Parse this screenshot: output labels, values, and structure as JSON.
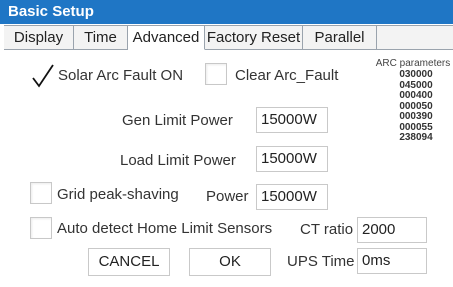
{
  "window": {
    "title": "Basic Setup"
  },
  "tabs": [
    {
      "label": "Display",
      "active": false
    },
    {
      "label": "Time",
      "active": false
    },
    {
      "label": "Advanced",
      "active": true
    },
    {
      "label": "Factory Reset",
      "active": false
    },
    {
      "label": "Parallel",
      "active": false
    }
  ],
  "solar_arc_fault": {
    "label": "Solar Arc Fault ON",
    "checked": true
  },
  "clear_arc_fault": {
    "label": "Clear Arc_Fault",
    "checked": false
  },
  "arc_parameters": {
    "title": "ARC parameters",
    "values": [
      "030000",
      "045000",
      "000400",
      "000050",
      "000390",
      "000055",
      "238094"
    ]
  },
  "gen_limit_power": {
    "label": "Gen Limit Power",
    "value": "15000W"
  },
  "load_limit_power": {
    "label": "Load Limit Power",
    "value": "15000W"
  },
  "grid_peak_shaving": {
    "label": "Grid peak-shaving",
    "checked": false,
    "power_label": "Power",
    "power_value": "15000W"
  },
  "auto_detect": {
    "label": "Auto detect Home Limit Sensors",
    "checked": false
  },
  "ct_ratio": {
    "label": "CT ratio",
    "value": "2000"
  },
  "ups_time": {
    "label": "UPS Time",
    "value": "0ms"
  },
  "buttons": {
    "cancel": "CANCEL",
    "ok": "OK"
  }
}
